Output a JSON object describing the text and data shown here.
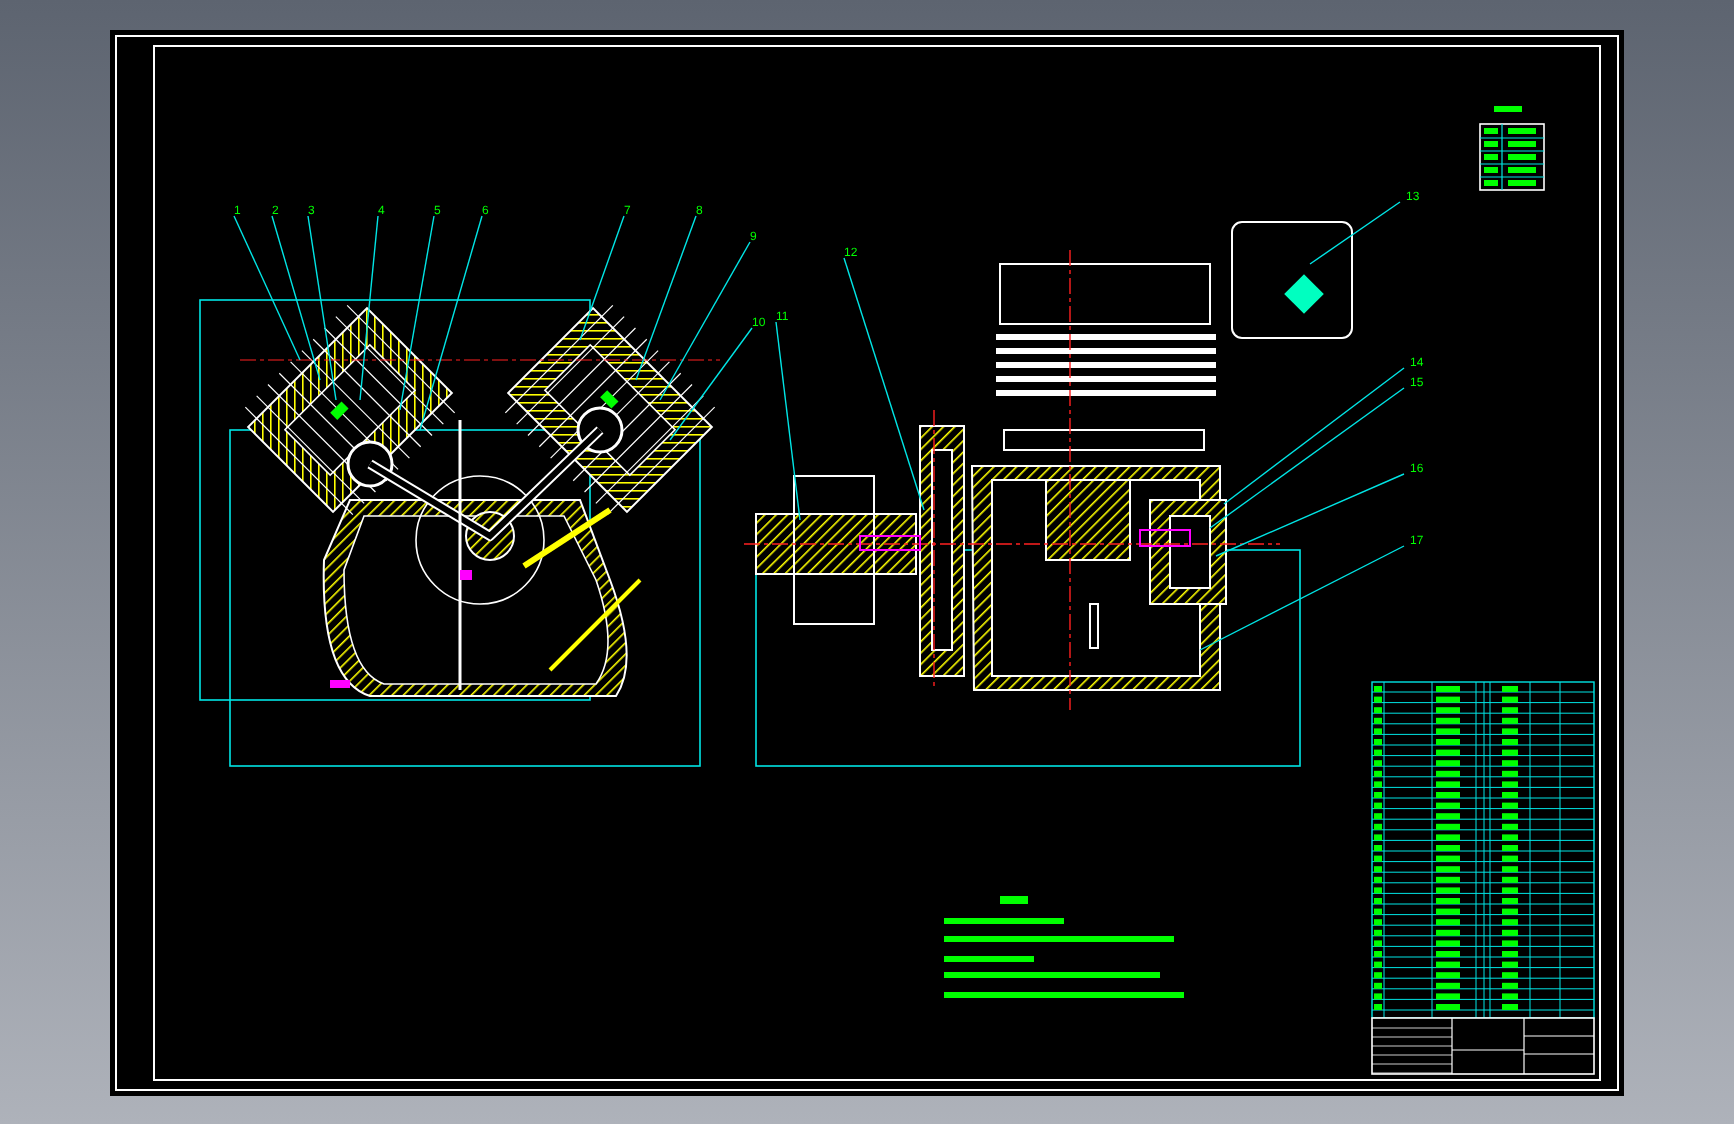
{
  "drawing": {
    "callouts": [
      {
        "label": "1"
      },
      {
        "label": "2"
      },
      {
        "label": "3"
      },
      {
        "label": "4"
      },
      {
        "label": "5"
      },
      {
        "label": "6"
      },
      {
        "label": "7"
      },
      {
        "label": "8"
      },
      {
        "label": "9"
      },
      {
        "label": "10"
      },
      {
        "label": "11"
      },
      {
        "label": "12"
      },
      {
        "label": "13"
      },
      {
        "label": "14"
      },
      {
        "label": "15"
      },
      {
        "label": "16"
      },
      {
        "label": "17"
      }
    ]
  }
}
